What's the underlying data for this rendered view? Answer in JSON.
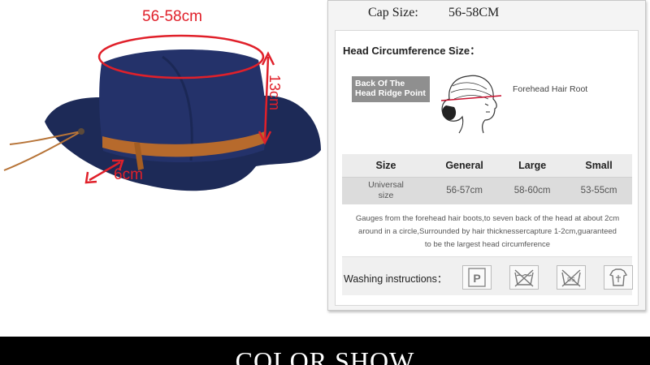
{
  "hat": {
    "circumference_label": "56-58cm",
    "height_label": "13cm",
    "brim_label": "6cm",
    "colors": {
      "felt": "#1d2a57",
      "band": "#b76a2c",
      "marker": "#e0202a"
    }
  },
  "panel": {
    "cap_size_label": "Cap Size:",
    "cap_size_value": "56-58CM",
    "head_title": "Head Circumference Size：",
    "back_point_line1": "Back Of The",
    "back_point_line2": "Head Ridge Point",
    "forehead_label": "Forehead Hair Root",
    "table": {
      "headers": [
        "Size",
        "General",
        "Large",
        "Small"
      ],
      "row_label_line1": "Universal",
      "row_label_line2": "size",
      "values": [
        "56-57cm",
        "58-60cm",
        "53-55cm"
      ]
    },
    "note": {
      "line1": "Gauges from the forehead hair boots,to seven back of the head at about 2cm",
      "line2": "around in a circle,Surrounded by hair thicknessercapture 1-2cm,guaranteed",
      "line3": "to be the largest head circumference"
    },
    "washing_label": "Washing instructions：",
    "washing_icons": [
      "dry-clean-p-icon",
      "do-not-wash-icon",
      "do-not-tumble-dry-icon",
      "hang-dry-icon"
    ],
    "washing_icon_texts": {
      "p": "P",
      "ds": "DS"
    }
  },
  "footer": {
    "title": "COLOR SHOW"
  }
}
